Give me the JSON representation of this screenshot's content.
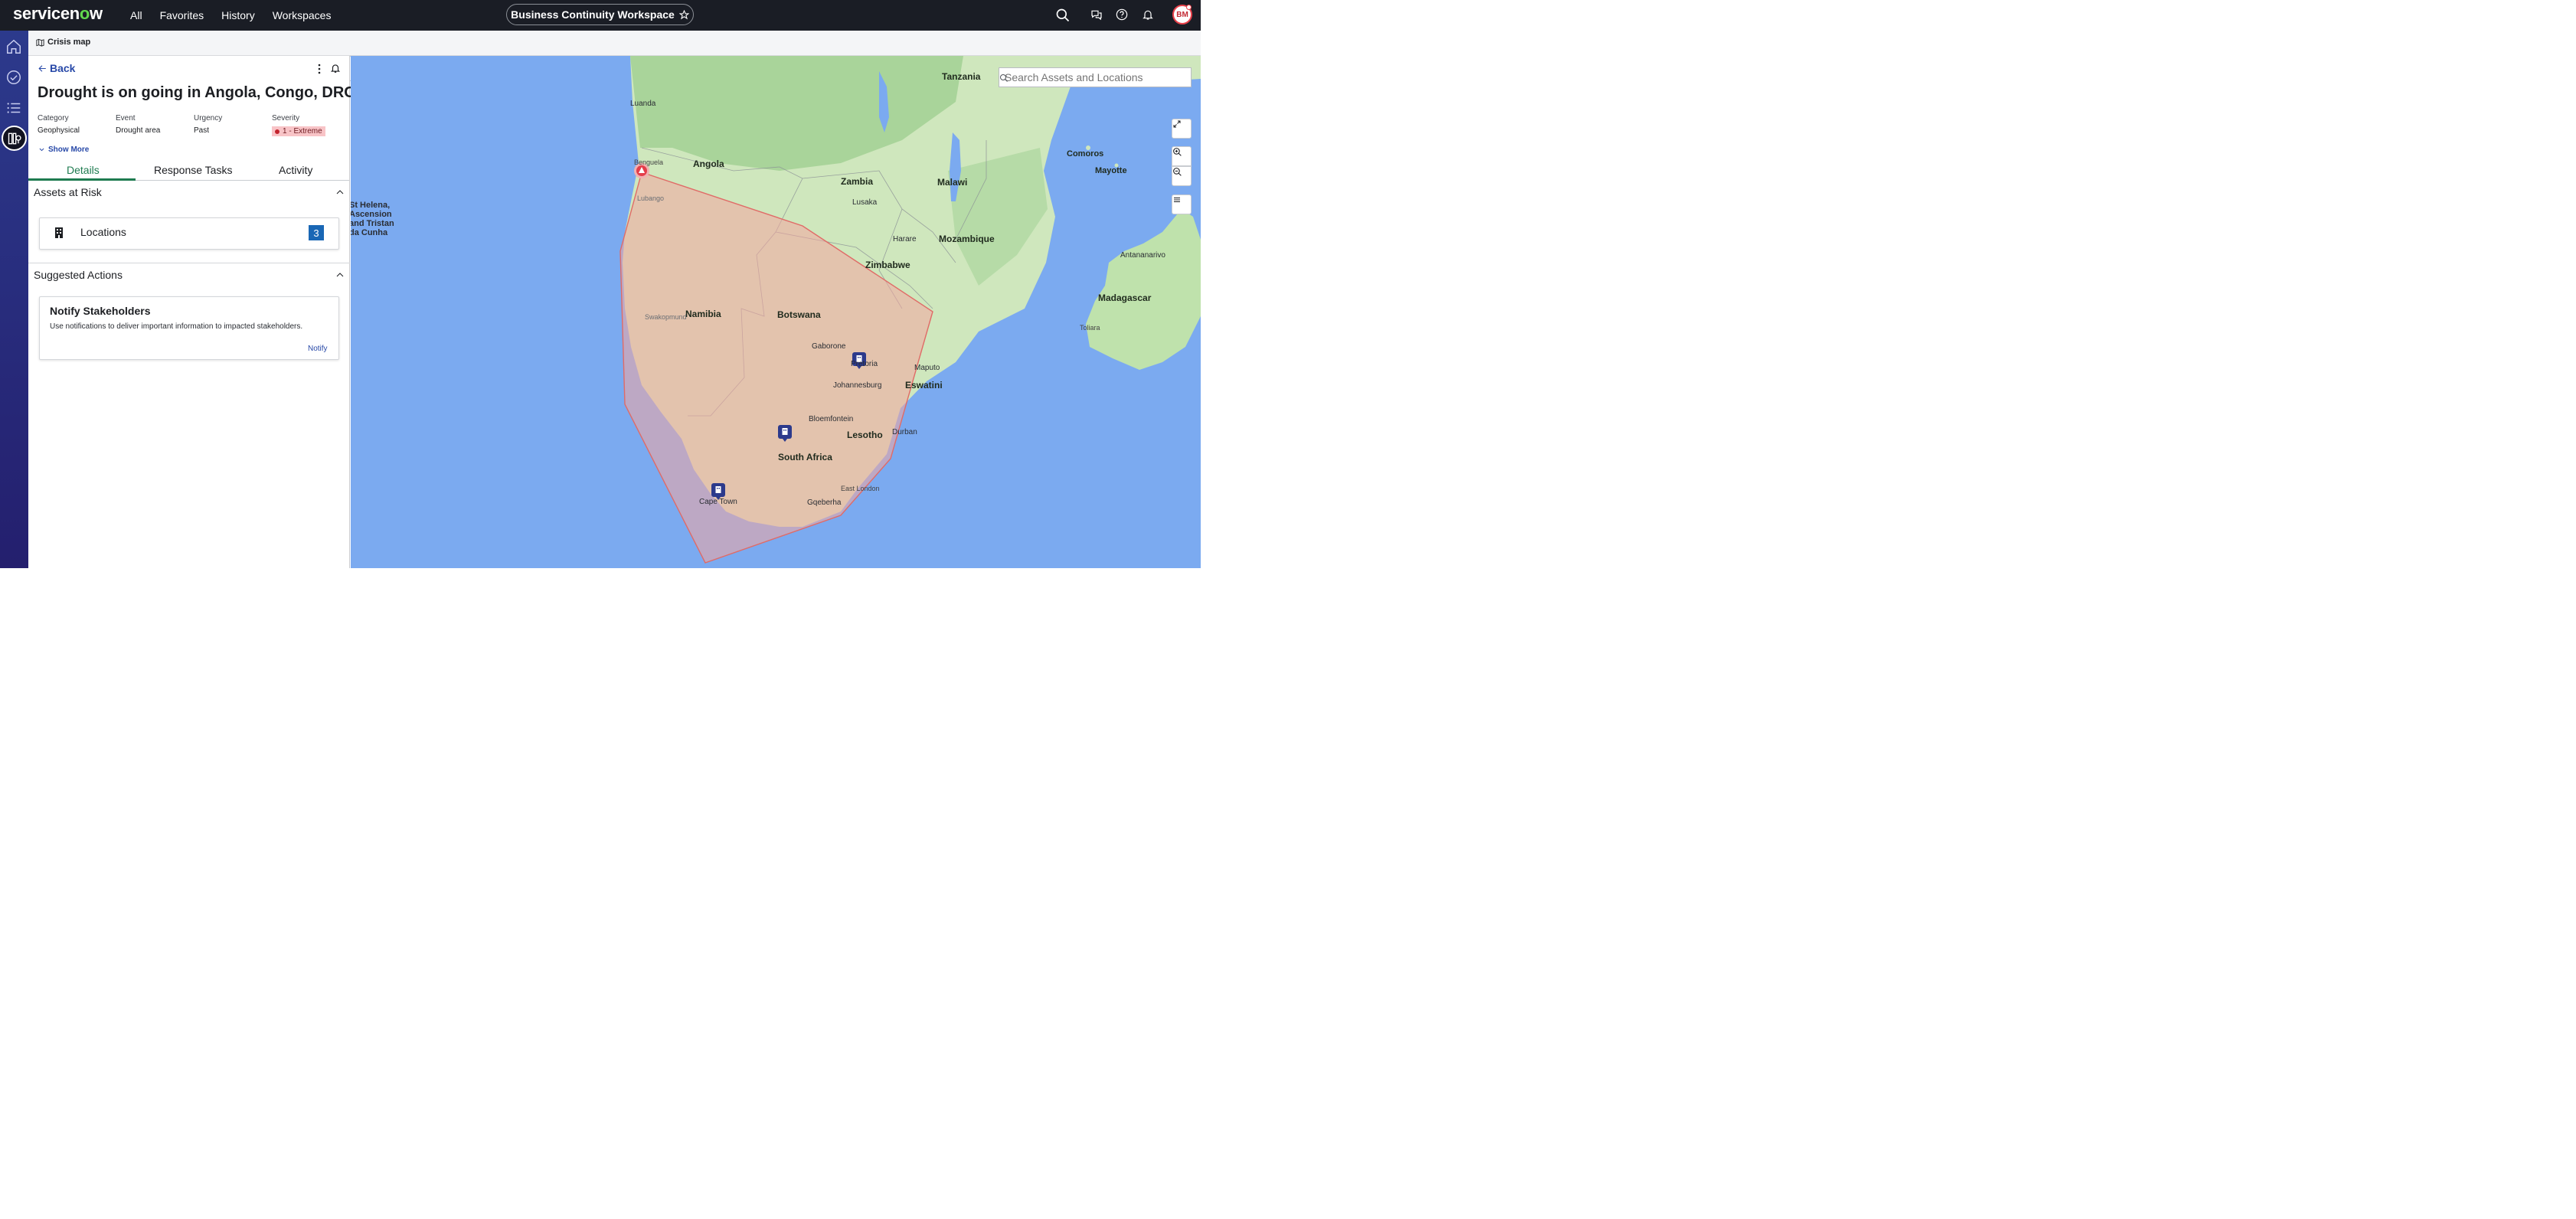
{
  "topbar": {
    "logo_prefix": "servicen",
    "logo_o": "o",
    "logo_suffix": "w",
    "nav": [
      "All",
      "Favorites",
      "History",
      "Workspaces"
    ],
    "workspace_title": "Business Continuity Workspace",
    "avatar_initials": "BM"
  },
  "subheader": {
    "tab_label": "Crisis map"
  },
  "panel": {
    "back_label": "Back",
    "title": "Drought is on going in Angola, Congo, DRC",
    "meta": [
      {
        "label": "Category",
        "value": "Geophysical"
      },
      {
        "label": "Event",
        "value": "Drought area"
      },
      {
        "label": "Urgency",
        "value": "Past"
      },
      {
        "label": "Severity",
        "value": "1 - Extreme"
      }
    ],
    "show_more": "Show More",
    "tabs": [
      "Details",
      "Response Tasks",
      "Activity"
    ],
    "assets_heading": "Assets at Risk",
    "locations_label": "Locations",
    "locations_count": "3",
    "suggested_heading": "Suggested Actions",
    "notify_title": "Notify Stakeholders",
    "notify_desc": "Use notifications to deliver important information to impacted stakeholders.",
    "notify_link": "Notify"
  },
  "map": {
    "search_placeholder": "Search Assets and Locations",
    "countries": [
      "Tanzania",
      "Angola",
      "Zambia",
      "Malawi",
      "Comoros",
      "Mayotte",
      "Mozambique",
      "Zimbabwe",
      "Namibia",
      "Botswana",
      "Madagascar",
      "Eswatini",
      "Lesotho",
      "South Africa"
    ],
    "cities": [
      "Luanda",
      "Benguela",
      "Lubango",
      "Lusaka",
      "Harare",
      "Antananarivo",
      "Swakopmund",
      "Gaborone",
      "Pretoria",
      "Johannesburg",
      "Maputo",
      "Toliara",
      "Bloemfontein",
      "Durban",
      "Cape Town",
      "East London",
      "Gqeberha"
    ],
    "st_helena": [
      "St Helena,",
      "Ascension",
      "and Tristan",
      "da Cunha"
    ],
    "colors": {
      "water": "#7baaf0",
      "land": "#d6ecc6",
      "forest": "#a9d49a",
      "polygon": "#f4a6a0"
    }
  }
}
